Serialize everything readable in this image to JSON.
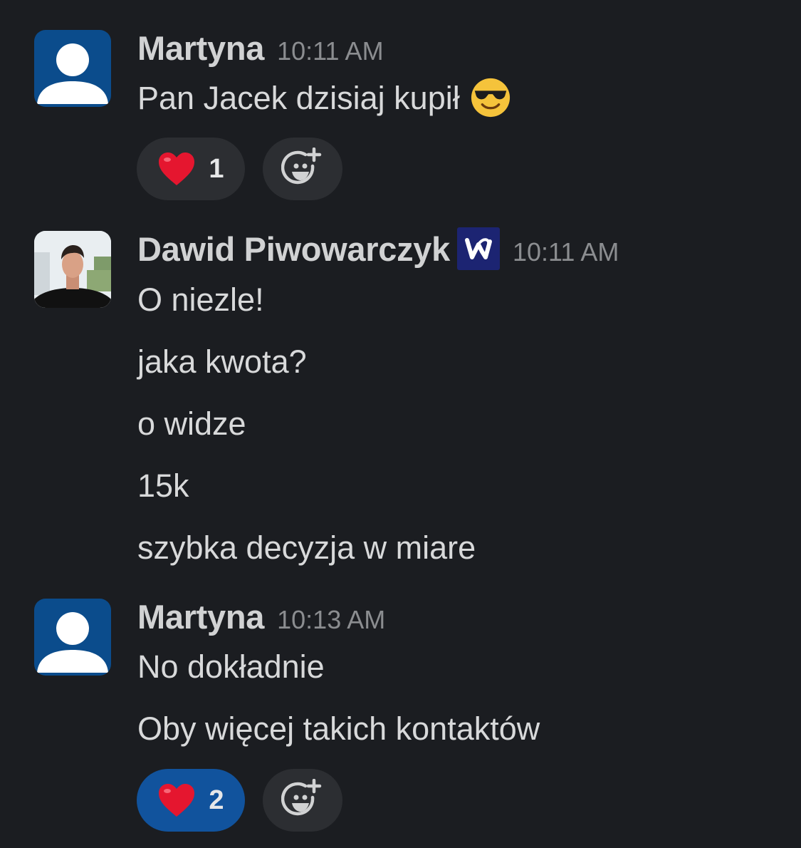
{
  "messages": [
    {
      "author": "Martyna",
      "time": "10:11 AM",
      "avatar": "default-user-icon",
      "lines": [
        "Pan Jacek dzisiaj kupił"
      ],
      "inline_emoji": "sunglasses-emoji-icon",
      "reactions": [
        {
          "emoji": "heart-emoji-icon",
          "count": "1",
          "active": false
        }
      ]
    },
    {
      "author": "Dawid Piwowarczyk",
      "time": "10:11 AM",
      "avatar": "profile-photo",
      "badge": "w-logo-badge-icon",
      "lines": [
        "O niezle!",
        "jaka kwota?",
        "o widze",
        "15k",
        "szybka decyzja w miare"
      ]
    },
    {
      "author": "Martyna",
      "time": "10:13 AM",
      "avatar": "default-user-icon",
      "lines": [
        "No dokładnie",
        "Oby więcej takich kontaktów"
      ],
      "reactions": [
        {
          "emoji": "heart-emoji-icon",
          "count": "2",
          "active": true
        }
      ]
    }
  ],
  "colors": {
    "background": "#1b1d21",
    "avatar_default": "#0b4c8c",
    "reaction_bg": "#2c2e32",
    "reaction_active_bg": "#11539d",
    "badge_bg": "#1c2472"
  }
}
